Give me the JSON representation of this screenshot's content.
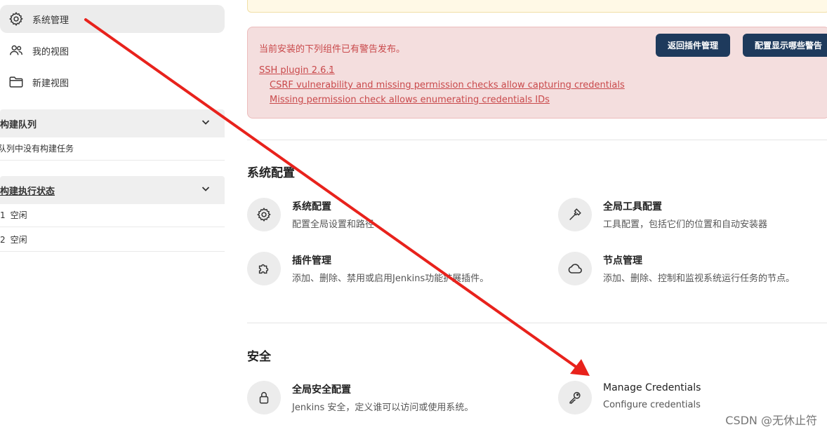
{
  "sidebar": {
    "nav": [
      {
        "label": "系统管理",
        "icon": "gear-icon",
        "active": true
      },
      {
        "label": "我的视图",
        "icon": "people-icon",
        "active": false
      },
      {
        "label": "新建视图",
        "icon": "folder-icon",
        "active": false
      }
    ],
    "build_queue": {
      "title": "构建队列",
      "empty_text": "队列中没有构建任务"
    },
    "executor_status": {
      "title": "构建执行状态",
      "rows": [
        {
          "num": "1",
          "status": "空闲"
        },
        {
          "num": "2",
          "status": "空闲"
        }
      ]
    }
  },
  "alert": {
    "message": "当前安装的下列组件已有警告发布。",
    "plugin_link": "SSH plugin 2.6.1",
    "plugin_colon": ":",
    "warnings": [
      "CSRF vulnerability and missing permission checks allow capturing credentials",
      "Missing permission check allows enumerating credentials IDs"
    ],
    "buttons": [
      "返回插件管理",
      "配置显示哪些警告"
    ]
  },
  "sections": [
    {
      "title": "系统配置",
      "items": [
        {
          "title": "系统配置",
          "desc": "配置全局设置和路径",
          "icon": "gear-icon"
        },
        {
          "title": "全局工具配置",
          "desc": "工具配置，包括它们的位置和自动安装器",
          "icon": "hammer-icon"
        },
        {
          "title": "插件管理",
          "desc": "添加、删除、禁用或启用Jenkins功能扩展插件。",
          "icon": "puzzle-icon"
        },
        {
          "title": "节点管理",
          "desc": "添加、删除、控制和监视系统运行任务的节点。",
          "icon": "cloud-icon"
        }
      ]
    },
    {
      "title": "安全",
      "items": [
        {
          "title": "全局安全配置",
          "desc": "Jenkins 安全，定义谁可以访问或使用系统。",
          "icon": "lock-icon"
        },
        {
          "title": "Manage Credentials",
          "desc": "Configure credentials",
          "icon": "key-icon"
        }
      ]
    }
  ],
  "watermark": "CSDN @无休止符",
  "colors": {
    "annotation_arrow": "#e8221c",
    "button_bg": "#1e3a5c",
    "alert_text": "#c9494b"
  }
}
